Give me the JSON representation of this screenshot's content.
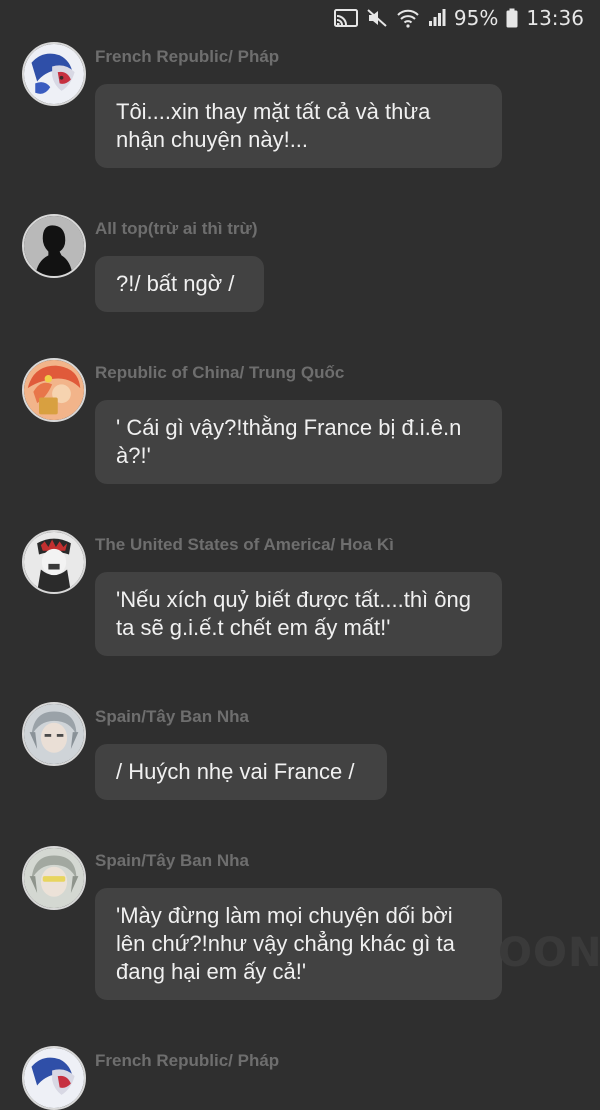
{
  "status_bar": {
    "battery": "95%",
    "time": "13:36",
    "icons": [
      "cast-icon",
      "mute-icon",
      "wifi-icon",
      "signal-icon",
      "battery-icon"
    ]
  },
  "messages": [
    {
      "sender": "French Republic/ Pháp",
      "text": "Tôi....xin thay mặt tất cả và thừa nhận chuyện này!...",
      "avatar": "french-republic-avatar"
    },
    {
      "sender": "All top(trừ ai thì trừ)",
      "text": "?!/ bất ngờ /",
      "avatar": "silhouette-avatar"
    },
    {
      "sender": "Republic of China/ Trung Quốc",
      "text": "' Cái gì vậy?!thằng France bị đ.i.ê.n à?!'",
      "avatar": "republic-of-china-avatar"
    },
    {
      "sender": "The United States of America/ Hoa Kì",
      "text": "'Nếu xích quỷ biết được tất....thì ông ta sẽ g.i.ế.t chết em ấy mất!'",
      "avatar": "usa-avatar"
    },
    {
      "sender": "Spain/Tây Ban Nha",
      "text": "/ Huých nhẹ vai France /",
      "avatar": "spain-avatar"
    },
    {
      "sender": "Spain/Tây Ban Nha",
      "text": "'Mày đừng làm mọi chuyện dối bời lên chứ?!như vậy chẳng khác gì ta đang hại em ấy cả!'",
      "avatar": "spain-avatar"
    },
    {
      "sender": "French Republic/ Pháp",
      "text": "",
      "avatar": "french-republic-avatar"
    }
  ],
  "watermark": "OON"
}
